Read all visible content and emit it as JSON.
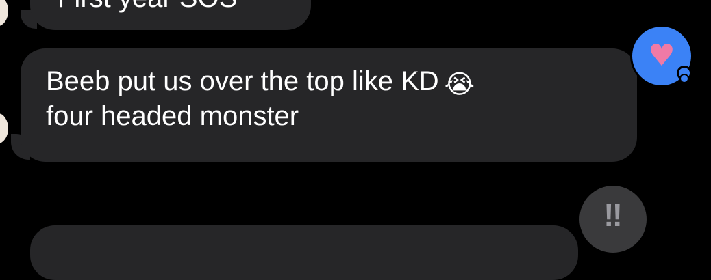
{
  "messages": [
    {
      "text": "First year SOS"
    },
    {
      "lines": [
        "Beeb put us over the top like KD",
        "four headed monster"
      ],
      "emoji": "😭"
    }
  ],
  "tapbacks": {
    "heart": {
      "icon": "heart-icon",
      "glyph": "♥",
      "color": "#3b82f6"
    },
    "exclamation": {
      "icon": "double-exclamation-icon",
      "glyph": "‼",
      "color": "#3a3a3c"
    }
  },
  "colors": {
    "background": "#000000",
    "bubble": "#262628",
    "text": "#ffffff",
    "heart": "#f07aa6"
  }
}
